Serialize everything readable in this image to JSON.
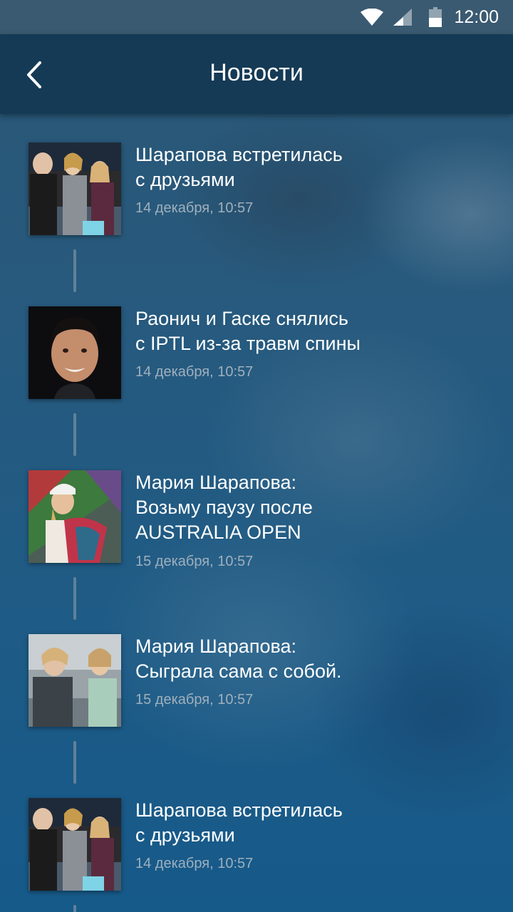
{
  "status_bar": {
    "time": "12:00",
    "icons": [
      "wifi-icon",
      "signal-icon",
      "battery-icon"
    ]
  },
  "app_bar": {
    "title": "Новости",
    "back_icon": "chevron-left-icon"
  },
  "news": [
    {
      "title_line1": "Шарапова встретилась",
      "title_line2": "с друзьями",
      "title_line3": "",
      "date": "14 декабря, 10:57",
      "thumbnail": "photo-sharapova-friends"
    },
    {
      "title_line1": "Раонич и Гаске снялись",
      "title_line2": "с IPTL из-за травм спины",
      "title_line3": "",
      "date": "14 декабря, 10:57",
      "thumbnail": "photo-raonic-portrait"
    },
    {
      "title_line1": "Мария Шарапова:",
      "title_line2": "Возьму паузу после",
      "title_line3": "AUSTRALIA OPEN",
      "date": "15 декабря, 10:57",
      "thumbnail": "photo-sharapova-towel"
    },
    {
      "title_line1": "Мария Шарапова:",
      "title_line2": "Сыграла сама с собой.",
      "title_line3": "",
      "date": "15 декабря, 10:57",
      "thumbnail": "photo-sharapova-double"
    },
    {
      "title_line1": "Шарапова встретилась",
      "title_line2": "с друзьями",
      "title_line3": "",
      "date": "14 декабря, 10:57",
      "thumbnail": "photo-sharapova-friends"
    }
  ],
  "colors": {
    "app_bar": "#153a55",
    "status_bar": "#3a5a72",
    "date_text": "#9fb0bd",
    "connector": "#5f8199"
  }
}
